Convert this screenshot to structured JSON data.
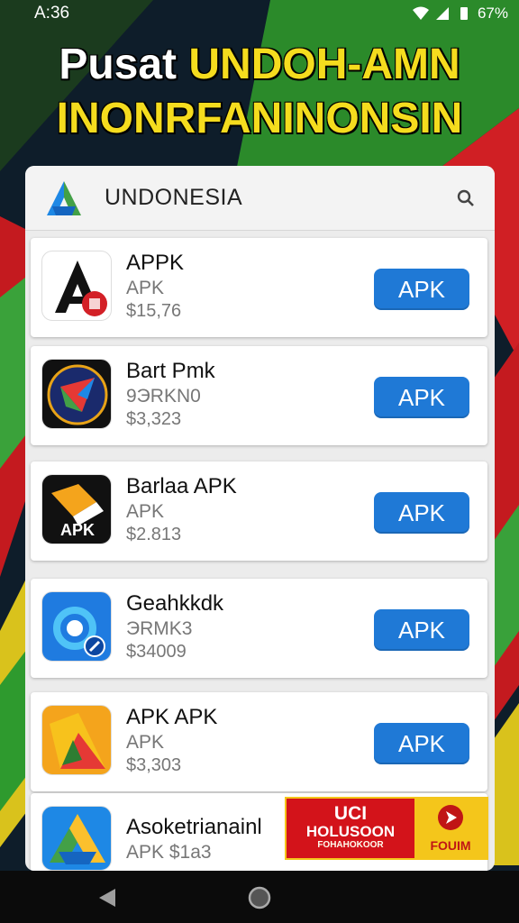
{
  "status_bar": {
    "time": "A:36",
    "battery": "67%"
  },
  "banner": {
    "word1": "Pusat",
    "word2": "UNDOH-AMN",
    "line2": "INONRFANINONSIN"
  },
  "search": {
    "text": "UNDONESIA"
  },
  "apps": [
    {
      "name": "APPK",
      "subtitle": "APK",
      "price": "$15,76",
      "button": "APK"
    },
    {
      "name": "Bart Pmk",
      "subtitle": "9ЭRKN0",
      "price": "$3,323",
      "button": "APK"
    },
    {
      "name": "Barlaa APK",
      "subtitle": "APK",
      "price": "$2.813",
      "button": "APK",
      "icon_label": "APK"
    },
    {
      "name": "Geahkkdk",
      "subtitle": "ЭRMK3",
      "price": "$34009",
      "button": "APK"
    },
    {
      "name": "APK APK",
      "subtitle": "APK",
      "price": "$3,303",
      "button": "APK"
    },
    {
      "name": "Asoketrianainl",
      "subtitle": "APK $1a3",
      "price": "",
      "button": ""
    }
  ],
  "ad": {
    "line1": "UCI",
    "line2": "HOLUSOON",
    "line3": "FOHAHOKOOR",
    "cta": "FOUIM"
  },
  "colors": {
    "accent": "#1f79d6",
    "banner_yellow": "#f5dc1e",
    "ad_red": "#d3131a"
  }
}
